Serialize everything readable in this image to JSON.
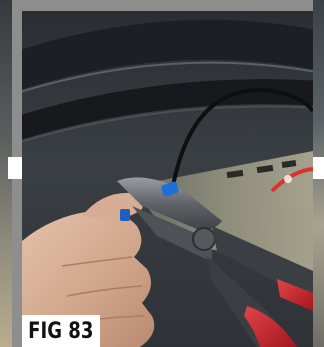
{
  "figure": {
    "label": "FIG 83"
  },
  "photo": {
    "subject": "hand-cutting-wire-with-pliers",
    "colors": {
      "background_dark": "#2b2f33",
      "trim_black": "#1b1d20",
      "skin": "#d8b29a",
      "plier_handle_red": "#c8232b",
      "plier_metal": "#6e7176",
      "connector_blue": "#1e6fd6",
      "frame_white": "#ffffff",
      "outer_grey": "#8e8e8e"
    }
  }
}
